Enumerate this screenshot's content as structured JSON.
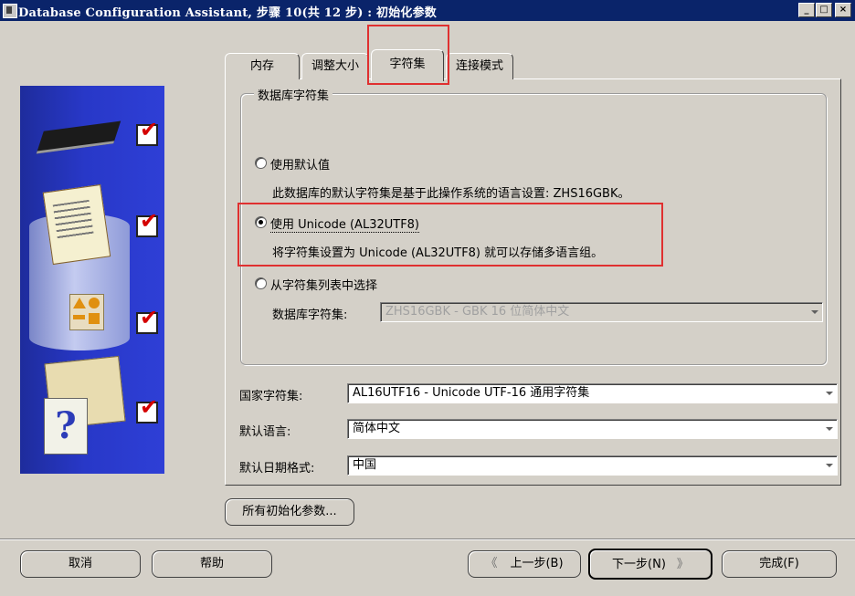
{
  "window": {
    "title": "Database Configuration Assistant, 步骤 10(共 12 步) : 初始化参数",
    "minimize": "_",
    "maximize": "□",
    "close": "×"
  },
  "tabs": [
    {
      "label": "内存"
    },
    {
      "label": "调整大小"
    },
    {
      "label": "字符集"
    },
    {
      "label": "连接模式"
    }
  ],
  "charset_group": {
    "legend": "数据库字符集",
    "option_default": {
      "label": "使用默认值",
      "description": "此数据库的默认字符集是基于此操作系统的语言设置: ZHS16GBK。",
      "selected": false
    },
    "option_unicode": {
      "label": "使用 Unicode (AL32UTF8)",
      "description": "将字符集设置为 Unicode (AL32UTF8) 就可以存储多语言组。",
      "selected": true
    },
    "option_list": {
      "label": "从字符集列表中选择",
      "selected": false,
      "field_label": "数据库字符集:",
      "field_value": "ZHS16GBK - GBK 16 位简体中文"
    }
  },
  "national_charset": {
    "label": "国家字符集:",
    "value": "AL16UTF16 - Unicode UTF-16 通用字符集"
  },
  "default_language": {
    "label": "默认语言:",
    "value": "简体中文"
  },
  "default_date_format": {
    "label": "默认日期格式:",
    "value": "中国"
  },
  "all_params_button": "所有初始化参数...",
  "footer": {
    "cancel": "取消",
    "help": "帮助",
    "back": "上一步(B)",
    "next": "下一步(N)",
    "finish": "完成(F)"
  },
  "icons": [
    "chip-icon",
    "database-cylinder-icon",
    "documents-icon",
    "shapes-icon",
    "folders-icon",
    "help-document-icon",
    "checkmark-icon"
  ],
  "colors": {
    "titlebar": "#0a246a",
    "highlight_box": "#e03030",
    "panel_blue": "#2838c8",
    "check_red": "#d40000"
  }
}
